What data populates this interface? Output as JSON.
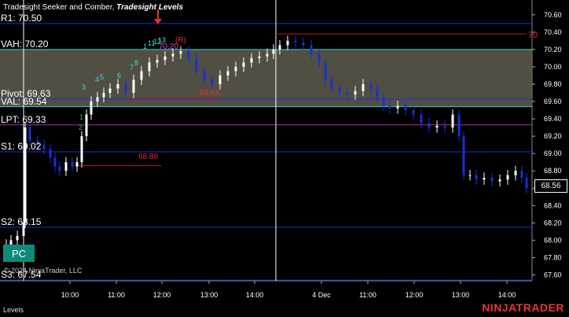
{
  "title": {
    "prefix": "Tradesight Seeker and Comber, ",
    "name": "Tradesight Levels"
  },
  "copyright": "© 2024 NinjaTrader, LLC",
  "status_label": "Levels",
  "brand": "NINJATRADER",
  "pc_button": "PC",
  "current_price": "68.56",
  "levels": [
    {
      "label": "R1: 70.50",
      "value": 70.5,
      "color": "#1a2fd6"
    },
    {
      "label": "VAH: 70.20",
      "value": 70.2,
      "color": "#35d0d0"
    },
    {
      "label": "Pivot: 69.63",
      "value": 69.63,
      "color": "#1a2fd6"
    },
    {
      "label": "VAL: 69.54",
      "value": 69.54,
      "color": "#35d0d0"
    },
    {
      "label": "LPT: 69.33",
      "value": 69.33,
      "color": "#a0309a"
    },
    {
      "label": "S1: 69.02",
      "value": 69.02,
      "color": "#1a2fd6"
    },
    {
      "label": "S2: 68.15",
      "value": 68.15,
      "color": "#1a2fd6"
    },
    {
      "label": "S3: 67.54",
      "value": 67.54,
      "color": "#1a2fd6"
    }
  ],
  "annotations": {
    "red_upper": "70.20",
    "red_right": "70",
    "red_mid": "69.64",
    "red_low": "68.86",
    "r_mark": "(R)",
    "seq_counts": [
      "1",
      "2",
      "3",
      "4",
      "5",
      "6",
      "7",
      "8",
      "1",
      "11",
      "12",
      "13"
    ]
  },
  "chart_data": {
    "type": "candlestick",
    "y_ticks": [
      "70.60",
      "70.40",
      "70.20",
      "70.00",
      "69.80",
      "69.60",
      "69.40",
      "69.20",
      "69.00",
      "68.80",
      "68.60",
      "68.40",
      "68.20",
      "68.00",
      "67.80",
      "67.60"
    ],
    "ylim": [
      67.55,
      70.68
    ],
    "x_ticks": [
      "10:00",
      "11:00",
      "12:00",
      "13:00",
      "14:00",
      "4 Dec",
      "11:00",
      "12:00",
      "13:00",
      "14:00"
    ],
    "value_area": [
      69.54,
      70.2
    ],
    "colors": {
      "up": "#ffffff",
      "down": "#1a2fd6",
      "value_area_fill": "#5a5849"
    }
  }
}
